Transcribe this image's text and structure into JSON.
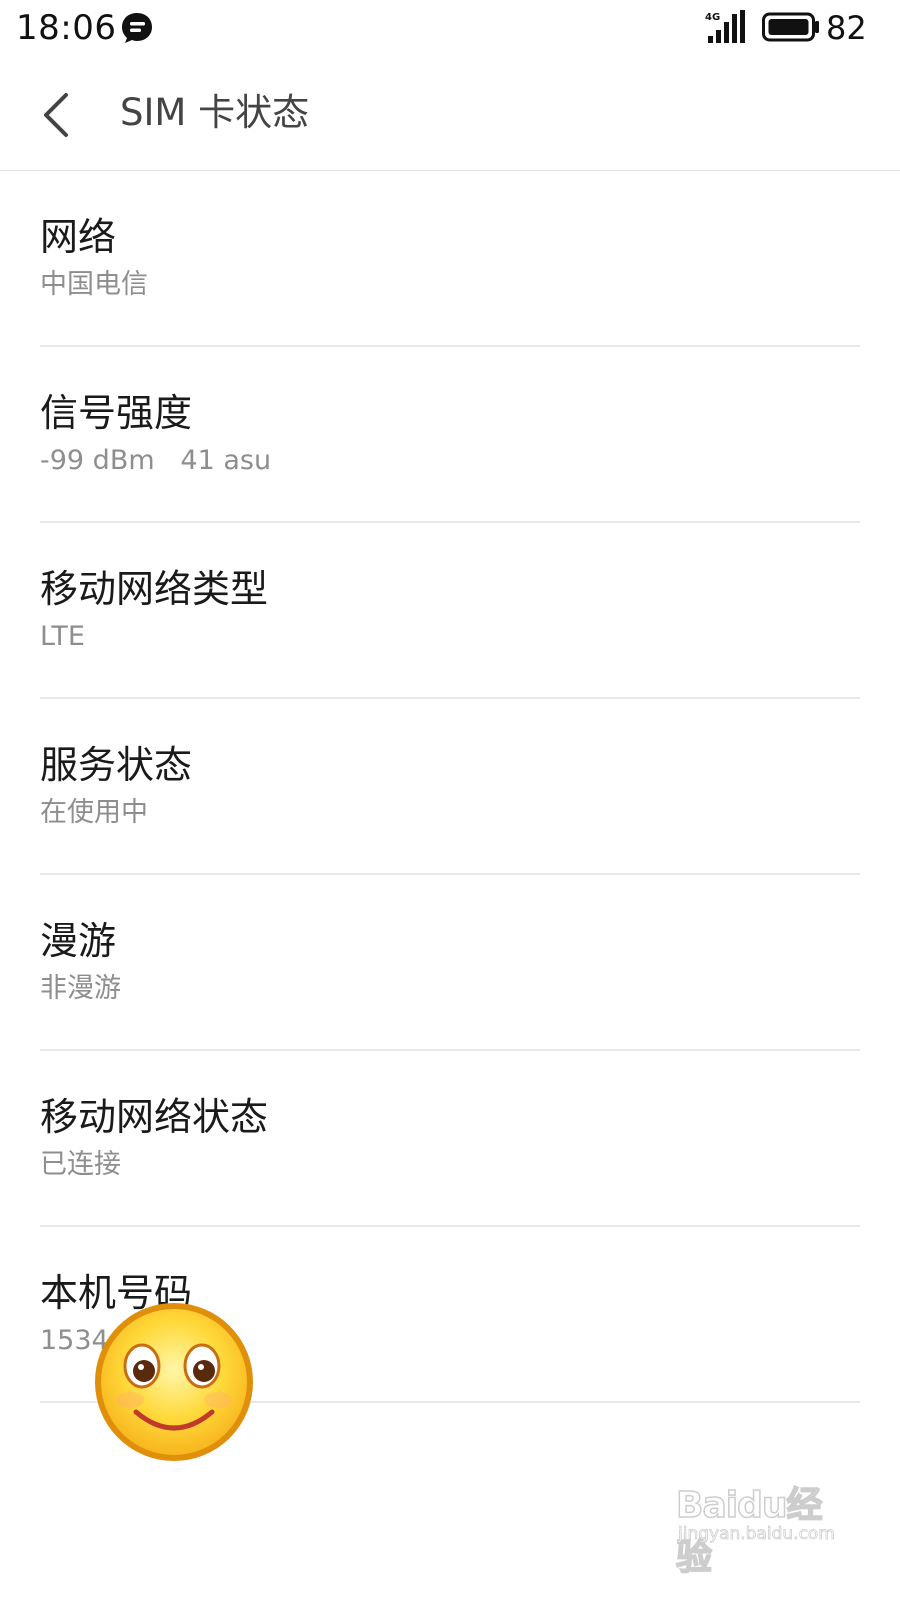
{
  "status_bar": {
    "time": "18:06",
    "network_badge": "4G",
    "battery_level": "82",
    "icons": [
      "message-icon",
      "signal-icon",
      "battery-icon"
    ]
  },
  "header": {
    "back_icon": "chevron-left-icon",
    "title": "SIM 卡状态"
  },
  "items": [
    {
      "title": "网络",
      "value": "中国电信"
    },
    {
      "title": "信号强度",
      "value": "-99 dBm   41 asu"
    },
    {
      "title": "移动网络类型",
      "value": "LTE"
    },
    {
      "title": "服务状态",
      "value": "在使用中"
    },
    {
      "title": "漫游",
      "value": "非漫游"
    },
    {
      "title": "移动网络状态",
      "value": "已连接"
    },
    {
      "title": "本机号码",
      "value": "1534"
    }
  ],
  "overlay": {
    "icon": "smiley-face-icon"
  },
  "watermark": {
    "brand": "Baidu经验",
    "site": "jingyan.baidu.com"
  },
  "colors": {
    "background": "#ffffff",
    "title_text": "#1a1a1a",
    "secondary_text": "#8e8e8e",
    "divider": "#e8e8e8"
  }
}
